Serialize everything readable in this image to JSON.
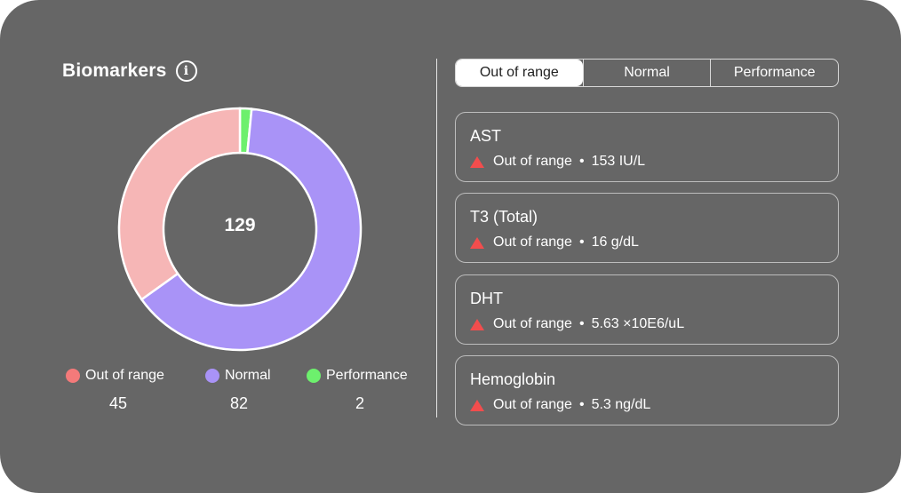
{
  "header": {
    "title": "Biomarkers",
    "info_icon": "info-icon"
  },
  "chart_data": {
    "type": "pie",
    "style": "donut",
    "total": "129",
    "categories": [
      "Out of range",
      "Normal",
      "Performance"
    ],
    "values": [
      45,
      82,
      2
    ],
    "colors": [
      "#f6b6b6",
      "#a993f7",
      "#6df06d"
    ],
    "legend_placement": "bottom"
  },
  "legend": [
    {
      "label": "Out of range",
      "value": "45",
      "color": "#f47a7a"
    },
    {
      "label": "Normal",
      "value": "82",
      "color": "#a993f7"
    },
    {
      "label": "Performance",
      "value": "2",
      "color": "#6df06d"
    }
  ],
  "tabs": [
    {
      "label": "Out of range",
      "active": true
    },
    {
      "label": "Normal",
      "active": false
    },
    {
      "label": "Performance",
      "active": false
    }
  ],
  "markers": [
    {
      "name": "AST",
      "status": "Out of range",
      "value": "153 IU/L"
    },
    {
      "name": "T3 (Total)",
      "status": "Out of range",
      "value": "16 g/dL"
    },
    {
      "name": "DHT",
      "status": "Out of range",
      "value": "5.63 ×10E6/uL"
    },
    {
      "name": "Hemoglobin",
      "status": "Out of range",
      "value": "5.3 ng/dL"
    }
  ],
  "status_icon": "warning-triangle-icon",
  "status_color": "#f24d4d"
}
